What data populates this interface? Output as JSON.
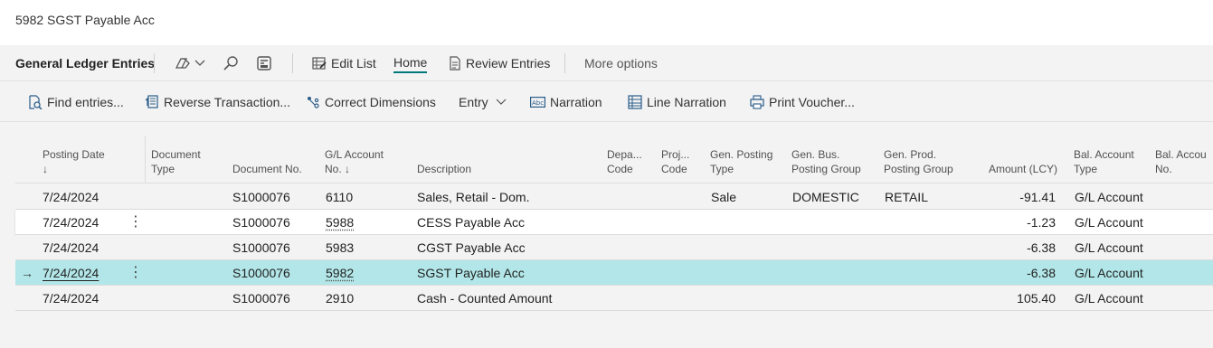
{
  "window": {
    "title": "5982 SGST Payable Acc"
  },
  "actionbar": {
    "page_title": "General Ledger Entries",
    "edit_list": "Edit List",
    "home": "Home",
    "review_entries": "Review Entries",
    "more_options": "More options"
  },
  "promoted": {
    "find_entries": "Find entries...",
    "reverse_transaction": "Reverse Transaction...",
    "correct_dimensions": "Correct Dimensions",
    "entry": "Entry",
    "narration": "Narration",
    "line_narration": "Line Narration",
    "print_voucher": "Print Voucher..."
  },
  "columns": {
    "posting_date": [
      "Posting Date",
      "↓"
    ],
    "document_type": [
      "Document",
      "Type"
    ],
    "document_no": "Document No.",
    "gl_account_no": [
      "G/L Account",
      "No. ↓"
    ],
    "description": "Description",
    "dept_code": [
      "Depa...",
      "Code"
    ],
    "proj_code": [
      "Proj...",
      "Code"
    ],
    "gen_posting_type": [
      "Gen. Posting",
      "Type"
    ],
    "gen_bus_posting_group": [
      "Gen. Bus.",
      "Posting Group"
    ],
    "gen_prod_posting_group": [
      "Gen. Prod.",
      "Posting Group"
    ],
    "amount_lcy": "Amount (LCY)",
    "bal_account_type": [
      "Bal. Account",
      "Type"
    ],
    "bal_account_no": [
      "Bal. Accou",
      "No."
    ]
  },
  "rows": [
    {
      "posting_date": "7/24/2024",
      "document_no": "S1000076",
      "account_no": "6110",
      "description": "Sales, Retail - Dom.",
      "gen_posting_type": "Sale",
      "gen_bus_posting_group": "DOMESTIC",
      "gen_prod_posting_group": "RETAIL",
      "amount": "-91.41",
      "bal_account_type": "G/L Account"
    },
    {
      "posting_date": "7/24/2024",
      "document_no": "S1000076",
      "account_no": "5988",
      "description": "CESS Payable Acc",
      "gen_posting_type": "",
      "gen_bus_posting_group": "",
      "gen_prod_posting_group": "",
      "amount": "-1.23",
      "bal_account_type": "G/L Account"
    },
    {
      "posting_date": "7/24/2024",
      "document_no": "S1000076",
      "account_no": "5983",
      "description": "CGST Payable Acc",
      "gen_posting_type": "",
      "gen_bus_posting_group": "",
      "gen_prod_posting_group": "",
      "amount": "-6.38",
      "bal_account_type": "G/L Account"
    },
    {
      "posting_date": "7/24/2024",
      "document_no": "S1000076",
      "account_no": "5982",
      "description": "SGST Payable Acc",
      "gen_posting_type": "",
      "gen_bus_posting_group": "",
      "gen_prod_posting_group": "",
      "amount": "-6.38",
      "bal_account_type": "G/L Account"
    },
    {
      "posting_date": "7/24/2024",
      "document_no": "S1000076",
      "account_no": "2910",
      "description": "Cash - Counted Amount",
      "gen_posting_type": "",
      "gen_bus_posting_group": "",
      "gen_prod_posting_group": "",
      "amount": "105.40",
      "bal_account_type": "G/L Account"
    }
  ],
  "row_markers": {
    "kebab": "⋮",
    "current_arrow": "→"
  },
  "colors": {
    "accent": "#00797a",
    "selected_row": "#b2e6e8"
  }
}
